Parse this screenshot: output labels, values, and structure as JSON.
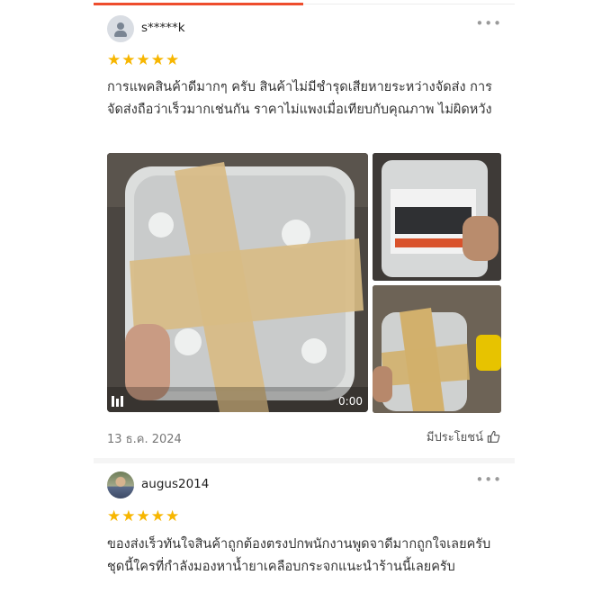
{
  "reviews": [
    {
      "username": "s*****k",
      "rating": 5,
      "text": "การแพคสินค้าดีมากๆ ครับ สินค้าไม่มีชำรุดเสียหายระหว่างจัดส่ง การจัดส่งถือว่าเร็วมากเช่นกัน ราคาไม่แพงเมื่อเทียบกับคุณภาพ ไม่ผิดหวัง",
      "video_duration": "0:00",
      "date": "13 ธ.ค. 2024",
      "helpful_label": "มีประโยชน์"
    },
    {
      "username": "augus2014",
      "rating": 5,
      "text": "ของส่งเร็วทันใจสินค้าถูกต้องตรงปกพนักงานพูดจาดีมากถูกใจเลยครับชุดนี้ใครที่กำลังมองหาน้ำยาเคลือบกระจกแนะนำร้านนี้เลยครับ"
    }
  ],
  "icons": {
    "more": "more-dots-icon",
    "star": "star-icon",
    "thumb": "thumbs-up-icon",
    "play": "video-play-icon"
  },
  "colors": {
    "accent": "#ee4d2d",
    "star": "#f7b600"
  }
}
